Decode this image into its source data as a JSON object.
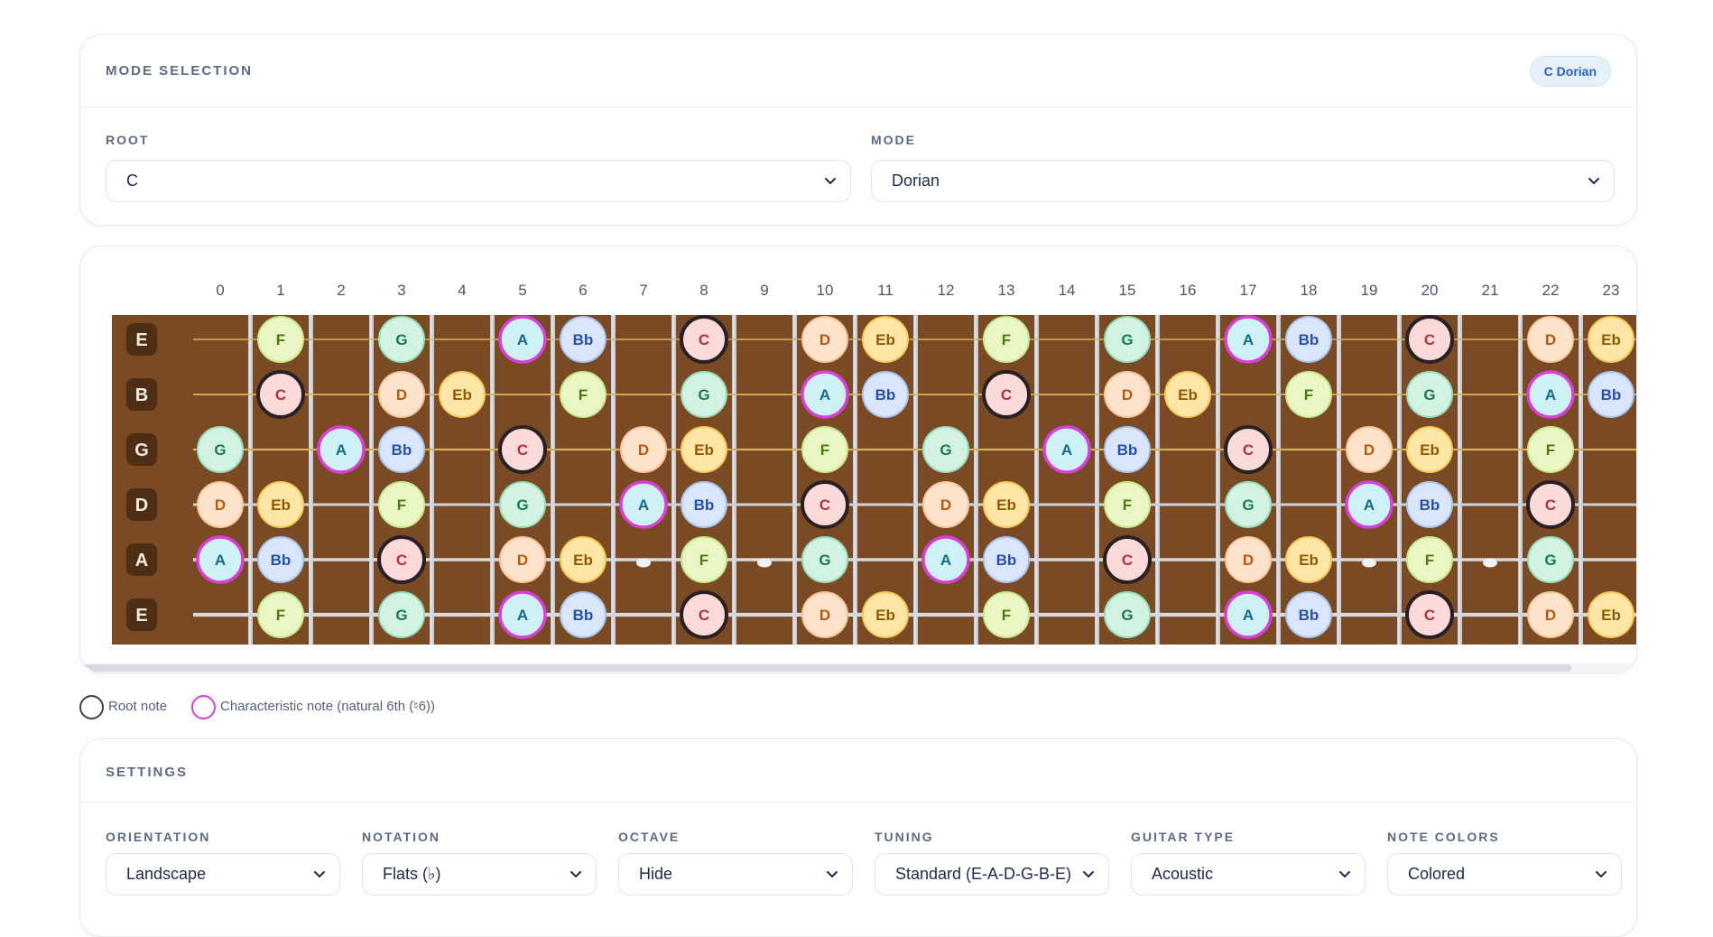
{
  "mode_selection": {
    "title": "MODE SELECTION",
    "badge": "C Dorian",
    "root_label": "ROOT",
    "root_value": "C",
    "mode_label": "MODE",
    "mode_value": "Dorian"
  },
  "fretboard": {
    "fret_numbers": [
      "0",
      "1",
      "2",
      "3",
      "4",
      "5",
      "6",
      "7",
      "8",
      "9",
      "10",
      "11",
      "12",
      "13",
      "14",
      "15",
      "16",
      "17",
      "18",
      "19",
      "20",
      "21",
      "22",
      "23"
    ],
    "string_names": [
      "E",
      "B",
      "G",
      "D",
      "A",
      "E"
    ],
    "strings": [
      [
        "",
        "F",
        "",
        "G",
        "",
        "A",
        "Bb",
        "",
        "C",
        "",
        "D",
        "Eb",
        "",
        "F",
        "",
        "G",
        "",
        "A",
        "Bb",
        "",
        "C",
        "",
        "D",
        "Eb"
      ],
      [
        "",
        "C",
        "",
        "D",
        "Eb",
        "",
        "F",
        "",
        "G",
        "",
        "A",
        "Bb",
        "",
        "C",
        "",
        "D",
        "Eb",
        "",
        "F",
        "",
        "G",
        "",
        "A",
        "Bb"
      ],
      [
        "G",
        "",
        "A",
        "Bb",
        "",
        "C",
        "",
        "D",
        "Eb",
        "",
        "F",
        "",
        "G",
        "",
        "A",
        "Bb",
        "",
        "C",
        "",
        "D",
        "Eb",
        "",
        "F",
        ""
      ],
      [
        "D",
        "Eb",
        "",
        "F",
        "",
        "G",
        "",
        "A",
        "Bb",
        "",
        "C",
        "",
        "D",
        "Eb",
        "",
        "F",
        "",
        "G",
        "",
        "A",
        "Bb",
        "",
        "C",
        ""
      ],
      [
        "A",
        "Bb",
        "",
        "C",
        "",
        "D",
        "Eb",
        "",
        "F",
        "",
        "G",
        "",
        "A",
        "Bb",
        "",
        "C",
        "",
        "D",
        "Eb",
        "",
        "F",
        "",
        "G",
        ""
      ],
      [
        "",
        "F",
        "",
        "G",
        "",
        "A",
        "Bb",
        "",
        "C",
        "",
        "D",
        "Eb",
        "",
        "F",
        "",
        "G",
        "",
        "A",
        "Bb",
        "",
        "C",
        "",
        "D",
        "Eb"
      ]
    ],
    "root_note": "C",
    "characteristic_note": "A",
    "fret_markers": [
      3,
      5,
      7,
      9,
      12,
      15,
      17,
      19,
      21
    ],
    "colors": {
      "fretboard": "#7a4a24",
      "string_label_bg": "#4e2e14",
      "root_ring": "#2a2024",
      "characteristic_ring": "#d63fd8"
    },
    "note_colors": {
      "C": {
        "fill": "#fbdada",
        "stroke": "#f2aaaa",
        "text": "#b0323a"
      },
      "D": {
        "fill": "#fde2cc",
        "stroke": "#f6c59a",
        "text": "#b45a12"
      },
      "Eb": {
        "fill": "#fde6a6",
        "stroke": "#f3c957",
        "text": "#8f5a06"
      },
      "F": {
        "fill": "#eaf7c4",
        "stroke": "#c8e88c",
        "text": "#4d7a12"
      },
      "G": {
        "fill": "#d3f3e2",
        "stroke": "#96dcbb",
        "text": "#1d7a50"
      },
      "A": {
        "fill": "#cdf1f5",
        "stroke": "#8cd8e4",
        "text": "#156a85"
      },
      "Bb": {
        "fill": "#d9e6fb",
        "stroke": "#a9c3f0",
        "text": "#2a4fa6"
      }
    }
  },
  "legend": {
    "root_label": "Root note",
    "characteristic_label": "Characteristic note (natural 6th (♮6))"
  },
  "settings": {
    "title": "SETTINGS",
    "fields": [
      {
        "label": "ORIENTATION",
        "value": "Landscape"
      },
      {
        "label": "NOTATION",
        "value": "Flats (♭)"
      },
      {
        "label": "OCTAVE",
        "value": "Hide"
      },
      {
        "label": "TUNING",
        "value": "Standard (E-A-D-G-B-E)"
      },
      {
        "label": "GUITAR TYPE",
        "value": "Acoustic"
      },
      {
        "label": "NOTE COLORS",
        "value": "Colored"
      }
    ]
  }
}
